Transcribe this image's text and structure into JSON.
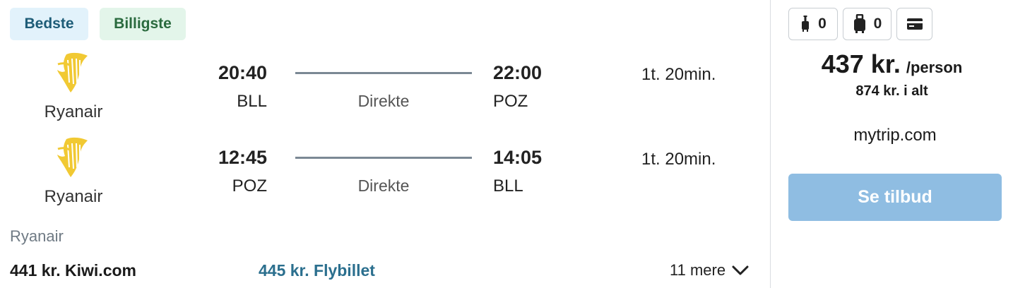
{
  "badges": {
    "best": "Bedste",
    "cheapest": "Billigste"
  },
  "legs": [
    {
      "airline": "Ryanair",
      "dep_time": "20:40",
      "dep_code": "BLL",
      "stops": "Direkte",
      "arr_time": "22:00",
      "arr_code": "POZ",
      "duration": "1t. 20min."
    },
    {
      "airline": "Ryanair",
      "dep_time": "12:45",
      "dep_code": "POZ",
      "stops": "Direkte",
      "arr_time": "14:05",
      "arr_code": "BLL",
      "duration": "1t. 20min."
    }
  ],
  "provider_airline": "Ryanair",
  "alt_prices": [
    "441 kr. Kiwi.com",
    "445 kr. Flybillet"
  ],
  "more_label": "11 mere",
  "bags": {
    "carry_on": "0",
    "checked": "0"
  },
  "price": {
    "main": "437 kr.",
    "unit": "/person",
    "total": "874 kr. i alt"
  },
  "seller": "mytrip.com",
  "cta_label": "Se tilbud",
  "icons": {
    "airline_logo": "ryanair-harp-icon",
    "carry_on": "carry-on-bag-icon",
    "checked": "checked-bag-icon",
    "card": "credit-card-icon",
    "more": "chevron-down-icon"
  },
  "colors": {
    "cta": "#8fbde2",
    "logo": "#f1c933",
    "best_badge_bg": "#e2f2fb",
    "cheap_badge_bg": "#e3f5ea",
    "alt_link": "#2b6f8e"
  }
}
